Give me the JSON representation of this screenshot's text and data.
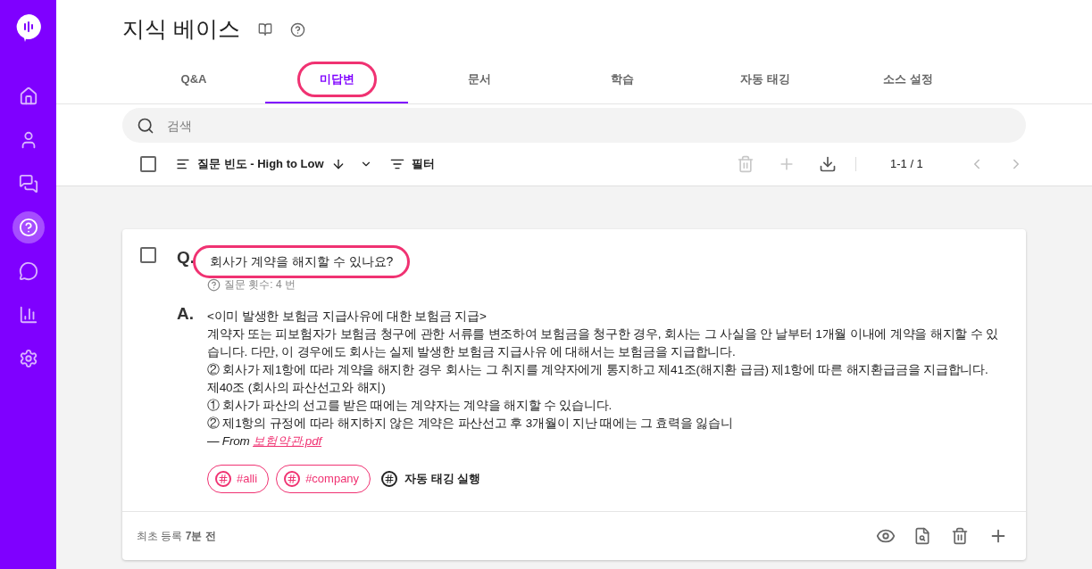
{
  "sidebar": {
    "items": [
      {
        "selected": false
      },
      {
        "selected": false
      },
      {
        "selected": false
      },
      {
        "selected": true
      },
      {
        "selected": false
      },
      {
        "selected": false
      },
      {
        "selected": false
      }
    ]
  },
  "header": {
    "title": "지식 베이스"
  },
  "tabs": [
    {
      "label": "Q&A",
      "selected": false,
      "highlighted": false
    },
    {
      "label": "미답변",
      "selected": true,
      "highlighted": true
    },
    {
      "label": "문서",
      "selected": false,
      "highlighted": false
    },
    {
      "label": "학습",
      "selected": false,
      "highlighted": false
    },
    {
      "label": "자동 태깅",
      "selected": false,
      "highlighted": false
    },
    {
      "label": "소스 설정",
      "selected": false,
      "highlighted": false
    }
  ],
  "search": {
    "placeholder": "검색"
  },
  "toolbar": {
    "select_all_checked": false,
    "sort": "질문 빈도 - High to Low",
    "filter": "필터",
    "pagination": "1-1 / 1"
  },
  "card": {
    "checked": false,
    "q_label": "Q.",
    "question": "회사가 계약을 해지할 수 있나요?",
    "question_highlighted": true,
    "ask_count": "질문 횟수: 4 번",
    "a_label": "A.",
    "answer_lines": [
      "<이미 발생한 보험금 지급사유에 대한 보험금 지급>",
      "계약자 또는 피보험자가 보험금 청구에 관한 서류를 변조하여 보험금을 청구한 경우, 회사는 그 사실을 안 날부터 1개월 이내에 계약을 해지할 수 있습니다. 다만, 이 경우에도 회사는 실제 발생한 보험금 지급사유 에 대해서는 보험금을 지급합니다.",
      "② 회사가 제1항에 따라 계약을 해지한 경우 회사는 그 취지를 계약자에게 통지하고 제41조(해지환 급금) 제1항에 따른 해지환급금을 지급합니다.",
      "제40조 (회사의 파산선고와 해지)",
      "① 회사가 파산의 선고를 받은 때에는 계약자는 계약을 해지할 수 있습니다.",
      "② 제1항의 규정에 따라 해지하지 않은 계약은 파산선고 후 3개월이 지난 때에는 그 효력을 잃습니"
    ],
    "source_prefix": "— From",
    "source_link": "보험약관.pdf",
    "tags": [
      "#alli",
      "#company"
    ],
    "auto_tag": "자동 태깅 실행",
    "created": "최초 등록 **7분 전**"
  }
}
